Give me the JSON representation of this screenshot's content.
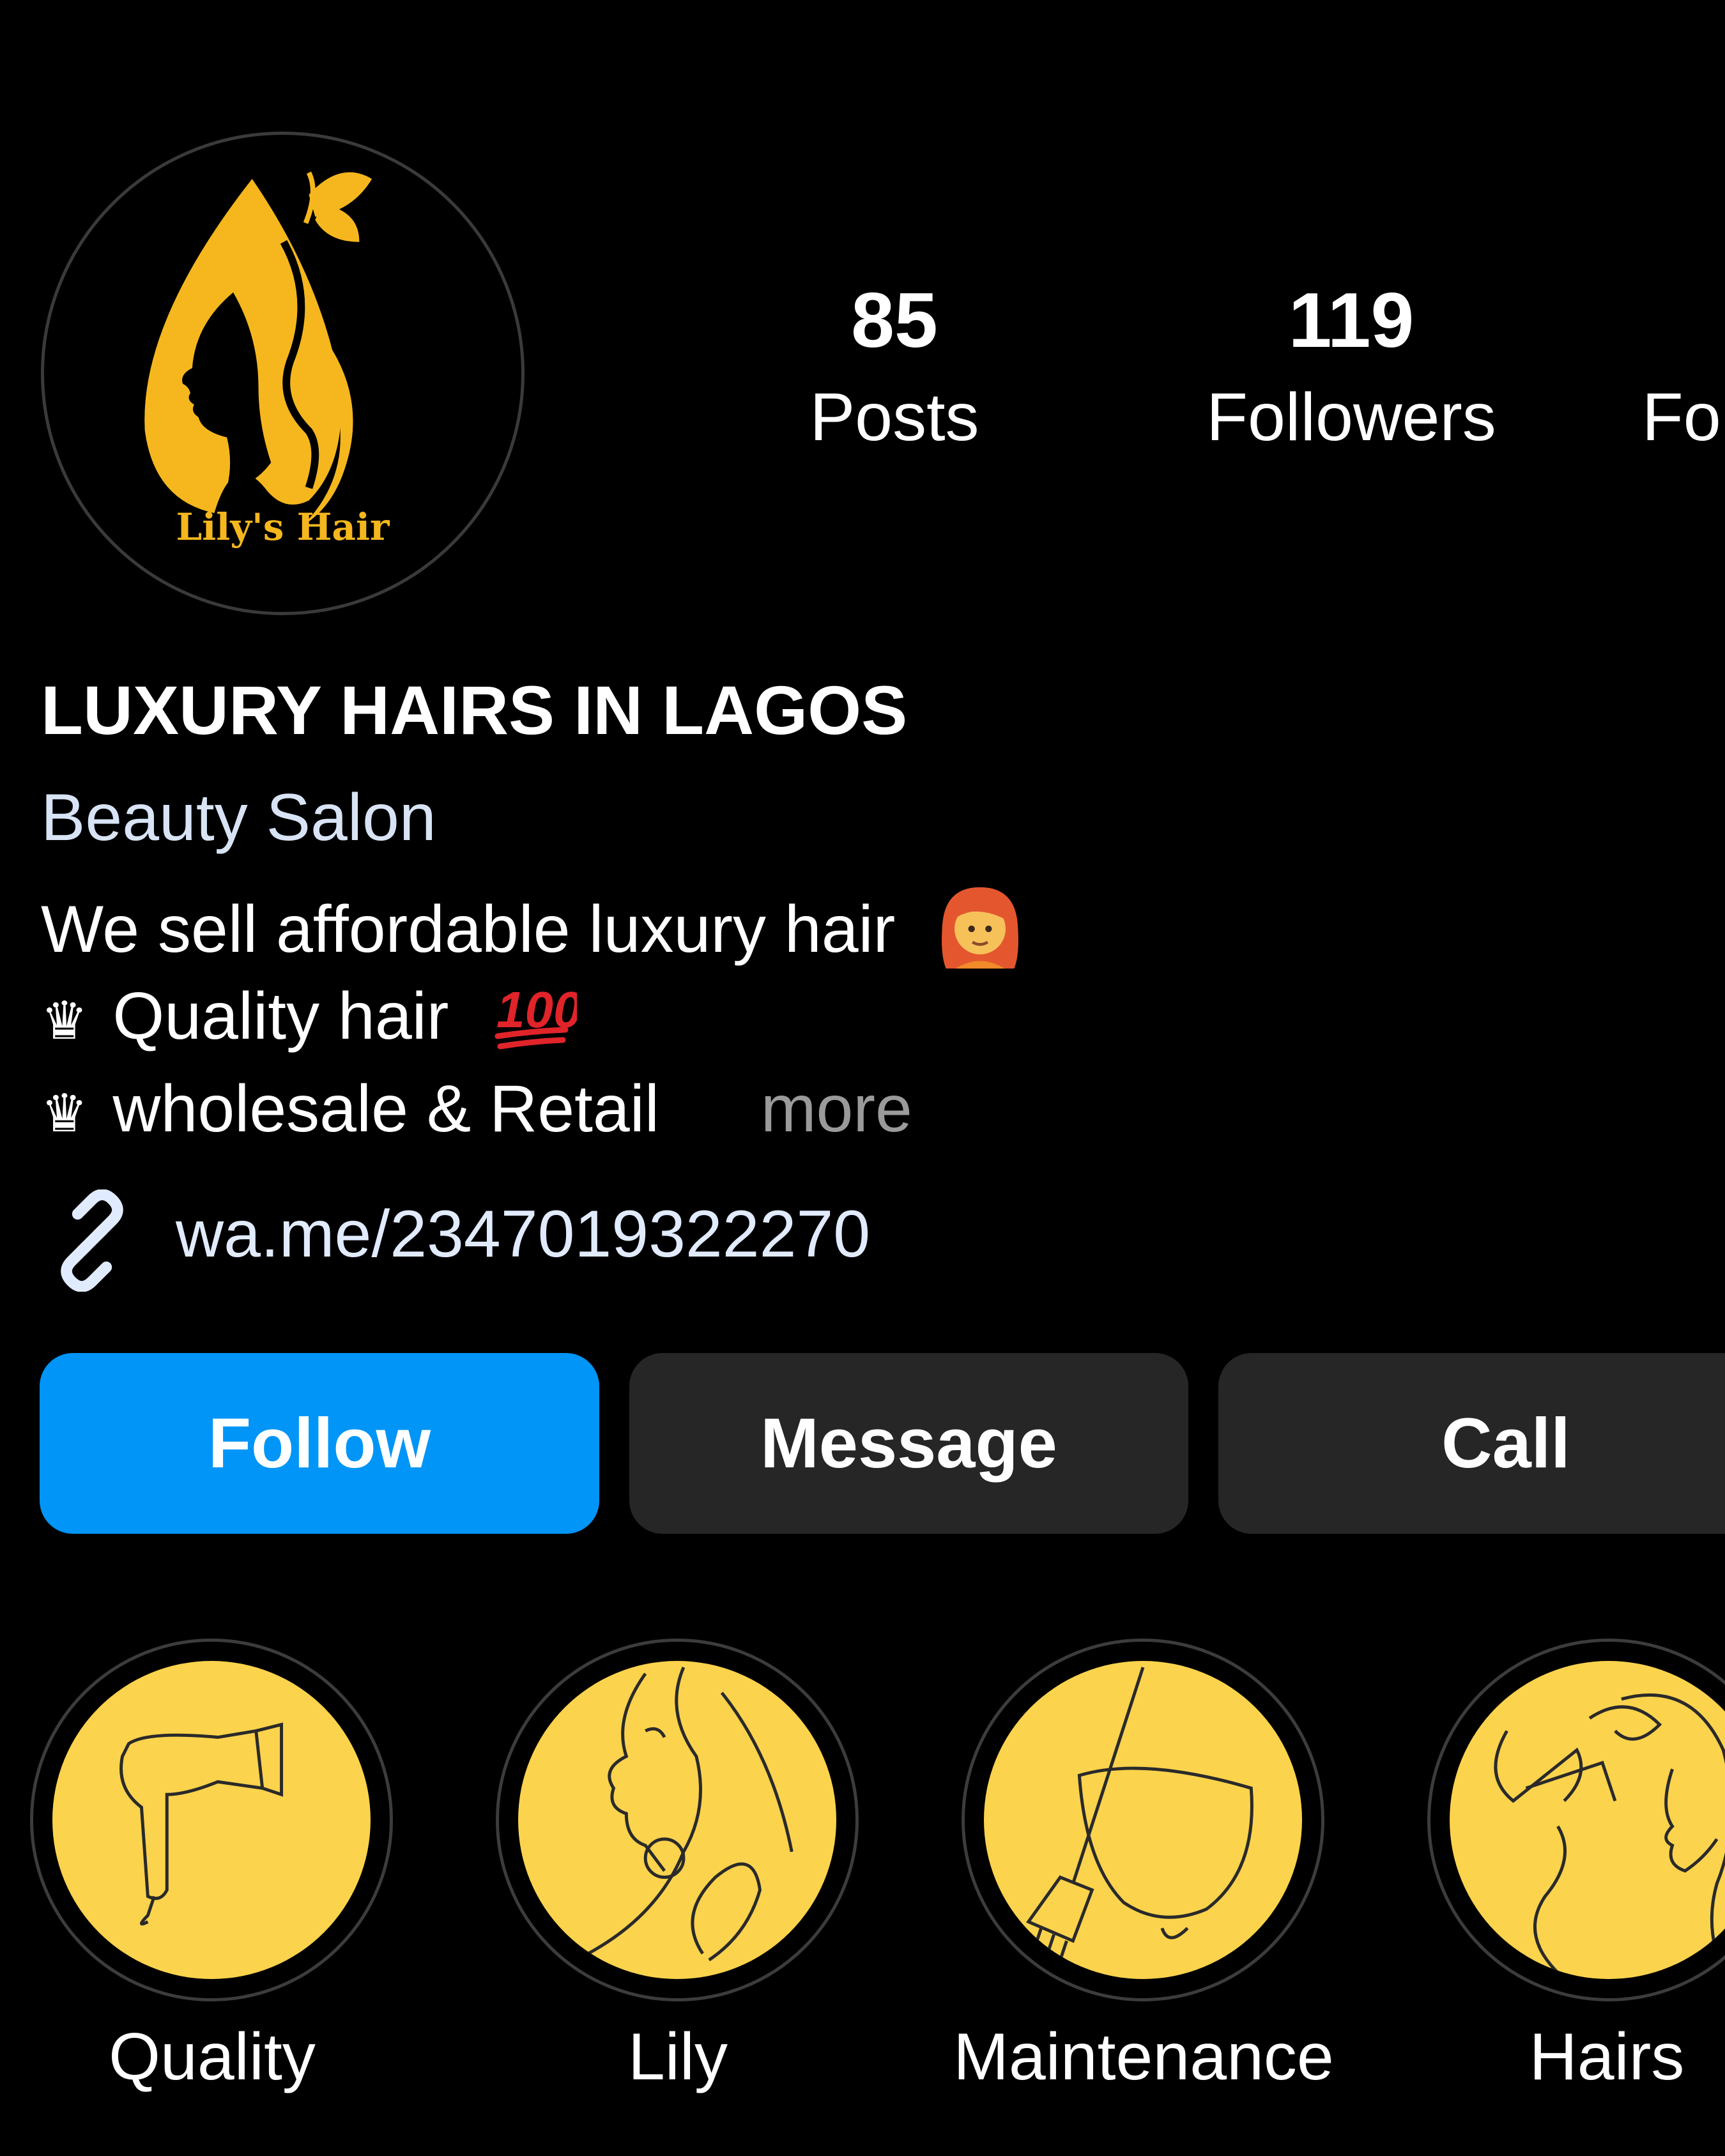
{
  "profile": {
    "avatar_icon": "lilys-hair-logo",
    "avatar_logo_text": "Lily's Hair",
    "brand_color": "#f5b71d",
    "stats": {
      "posts": {
        "value": "85",
        "label": "Posts"
      },
      "followers": {
        "value": "119",
        "label": "Followers"
      },
      "following": {
        "value": "",
        "label": "Fo"
      }
    }
  },
  "bio": {
    "name": "LUXURY HAIRS IN LAGOS",
    "category": "Beauty Salon",
    "line1": "We sell affordable luxury hair",
    "line1_emoji": "woman-red-hair-emoji",
    "line2": "Quality hair",
    "line2_emoji": "hundred-points-emoji",
    "line3": "wholesale & Retail",
    "more": "more",
    "link": "wa.me/2347019322270",
    "link_icon": "link-icon",
    "crown_glyph": "♛"
  },
  "actions": {
    "follow": "Follow",
    "message": "Message",
    "call": "Call",
    "follow_color": "#0095f6"
  },
  "highlights": [
    {
      "label": "Quality",
      "icon": "hair-dryer-icon"
    },
    {
      "label": "Lily",
      "icon": "face-line-art-icon"
    },
    {
      "label": "Maintenance",
      "icon": "dye-bowl-brush-icon"
    },
    {
      "label": "Hairs",
      "icon": "hair-styling-icon"
    }
  ],
  "highlight_color": "#fcd34d"
}
